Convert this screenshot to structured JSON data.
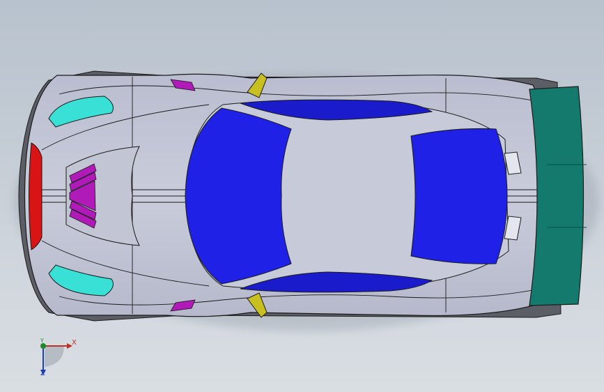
{
  "viewport": {
    "background_top": "#b8c2cd",
    "background_bottom": "#d9dee3"
  },
  "model": {
    "body_color": "#c4c7d6",
    "edge_color": "#1a1a1a",
    "glass_color": "#1f22e6",
    "side_glass_color": "#1a1ccc",
    "headlight_color": "#39e0d6",
    "vent_color": "#b01ab8",
    "mirror_color": "#c8c020",
    "taillight_color": "#d81414",
    "wing_color": "#137a6d"
  },
  "triad": {
    "x_label": "X",
    "y_label": "Y",
    "z_label": "Z",
    "x_color": "#c0302a",
    "y_color": "#1c8a2a",
    "z_color": "#1f3fb0"
  }
}
